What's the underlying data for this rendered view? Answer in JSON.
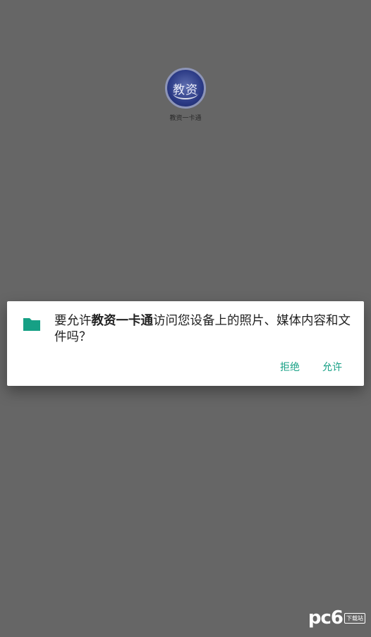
{
  "splash": {
    "logo_text": "教资",
    "app_name": "教资一卡通"
  },
  "dialog": {
    "message_prefix": "要允许",
    "app_name": "教资一卡通",
    "message_suffix": "访问您设备上的照片、媒体内容和文件吗？",
    "deny_label": "拒绝",
    "allow_label": "允许",
    "icon": "folder-icon"
  },
  "watermark": {
    "brand": "pc6",
    "sub": "下载站"
  },
  "colors": {
    "background": "#666666",
    "accent": "#16a085",
    "dialog_bg": "#ffffff"
  }
}
